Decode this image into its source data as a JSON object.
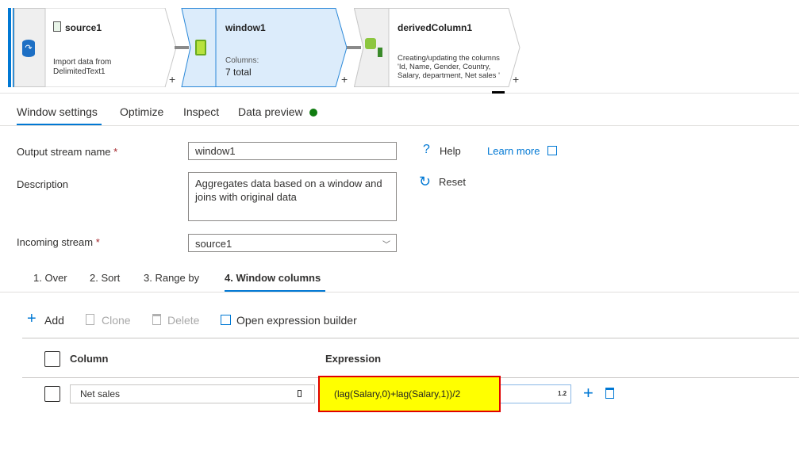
{
  "pipeline": {
    "nodes": [
      {
        "title": "source1",
        "desc": [
          "Import data from",
          "DelimitedText1"
        ],
        "icon": "csv-file-icon",
        "type_icon": "database-source-icon"
      },
      {
        "title": "window1",
        "desc_label": "Columns:",
        "desc_value": "7 total",
        "icon": "window-transform-icon"
      },
      {
        "title": "derivedColumn1",
        "desc": [
          "Creating/updating the columns",
          "'Id, Name, Gender, Country,",
          "Salary, department,  Net sales '"
        ],
        "icon": "derived-column-icon"
      }
    ],
    "add_symbol": "+"
  },
  "tabs": [
    {
      "label": "Window settings",
      "active": true
    },
    {
      "label": "Optimize"
    },
    {
      "label": "Inspect"
    },
    {
      "label": "Data preview",
      "status_color": "#107c10"
    }
  ],
  "form": {
    "output_stream_label": "Output stream name",
    "output_stream_value": "window1",
    "description_label": "Description",
    "description_value": "Aggregates data based on a window and joins with original data",
    "incoming_stream_label": "Incoming stream",
    "incoming_stream_value": "source1",
    "required_mark": "*",
    "help_label": "Help",
    "learn_more_label": "Learn more",
    "reset_label": "Reset"
  },
  "subtabs": [
    {
      "label": "1. Over"
    },
    {
      "label": "2. Sort"
    },
    {
      "label": "3. Range by"
    },
    {
      "label": "4. Window columns",
      "active": true
    }
  ],
  "toolbar": {
    "add": "Add",
    "clone": "Clone",
    "delete": "Delete",
    "open_builder": "Open expression builder"
  },
  "table": {
    "headers": {
      "column": "Column",
      "expression": "Expression"
    },
    "rows": [
      {
        "column": "Net sales",
        "expression": "(lag(Salary,0)+lag(Salary,1))/2",
        "type_badge": "1.2"
      }
    ]
  },
  "colors": {
    "accent": "#0078d4",
    "highlight": "#ffff00",
    "highlight_border": "#e00000",
    "selected_node": "#dcecfb"
  }
}
